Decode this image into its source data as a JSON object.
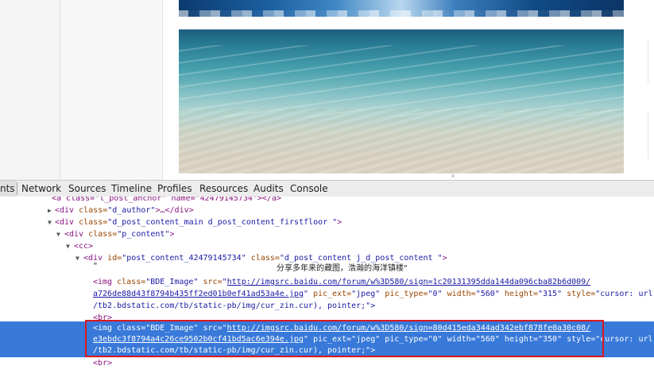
{
  "devtools": {
    "tabs": [
      {
        "label": "nts",
        "selected": true
      },
      {
        "label": "Network"
      },
      {
        "label": "Sources"
      },
      {
        "label": "Timeline"
      },
      {
        "label": "Profiles"
      },
      {
        "label": "Resources"
      },
      {
        "label": "Audits"
      },
      {
        "label": "Console"
      }
    ],
    "resize_handle": "⁞⁞",
    "tree": {
      "line0": "<a class=\"l_post_anchor\" name=\"42479145734\"></a>",
      "line1": {
        "open": "<div",
        "attr": "class=",
        "val": "\"d_author\"",
        "rest": ">…</div>"
      },
      "line2": {
        "open": "<div",
        "attr": "class=",
        "val": "\"d_post_content_main d_post_content_firstfloor \"",
        "close": ">"
      },
      "line3": {
        "open": "<div",
        "attr": "class=",
        "val": "\"p_content\"",
        "close": ">"
      },
      "line4": "<cc>",
      "line5": {
        "open": "<div",
        "a1": "id=",
        "v1": "\"post_content_42479145734\"",
        "a2": "class=",
        "v2": "\"d_post_content j_d_post_content \"",
        "close": ">"
      },
      "line6": {
        "quote": "\"",
        "text": "分享多年来的藏图，浩瀚的海洋镇楼\""
      },
      "img1": {
        "l1_open": "<img",
        "l1_a1": "class=",
        "l1_v1": "\"BDE_Image\"",
        "l1_a2": "src=",
        "l1_v2": "\"",
        "l1_link": "http://imgsrc.baidu.com/forum/w%3D580/sign=1c20131395dda144da096cba82b6d009/",
        "l2_link": "a726de88d43f8794b435ff2ed01b0ef41ad53a4e.jpg",
        "l2_q": "\"",
        "l2_a1": "pic_ext=",
        "l2_v1": "\"jpeg\"",
        "l2_a2": "pic_type=",
        "l2_v2": "\"0\"",
        "l2_a3": "width=",
        "l2_v3": "\"560\"",
        "l2_a4": "height=",
        "l2_v4": "\"315\"",
        "l2_a5": "style=",
        "l2_v5": "\"cursor: url(",
        "l3_text": "/tb2.bdstatic.com/tb/static-pb/img/cur_zin.cur), pointer;\">"
      },
      "br1": "<br>",
      "img2": {
        "l1_open": "<img",
        "l1_a1": "class=",
        "l1_v1": "\"BDE_Image\"",
        "l1_a2": "src=",
        "l1_v2": "\"",
        "l1_link": "http://imgsrc.baidu.com/forum/w%3D580/sign=80d415eda344ad342ebf878fe0a30c08/",
        "l2_link": "e3ebdc3f8794a4c26ce9502b0cf41bd5ac6e394e.jpg",
        "l2_q": "\"",
        "l2_a1": "pic_ext=",
        "l2_v1": "\"jpeg\"",
        "l2_a2": "pic_type=",
        "l2_v2": "\"0\"",
        "l2_a3": "width=",
        "l2_v3": "\"560\"",
        "l2_a4": "height=",
        "l2_v4": "\"350\"",
        "l2_a5": "style=",
        "l2_v5": "\"cursor: url(",
        "l3_text": "/tb2.bdstatic.com/tb/static-pb/img/cur_zin.cur), pointer;\">"
      },
      "br2": "<br>"
    }
  },
  "colors": {
    "selection": "#3879d9",
    "highlight_box": "#d9191e",
    "tag": "#881280",
    "attr_name": "#994500",
    "attr_value": "#1a1aa6"
  }
}
